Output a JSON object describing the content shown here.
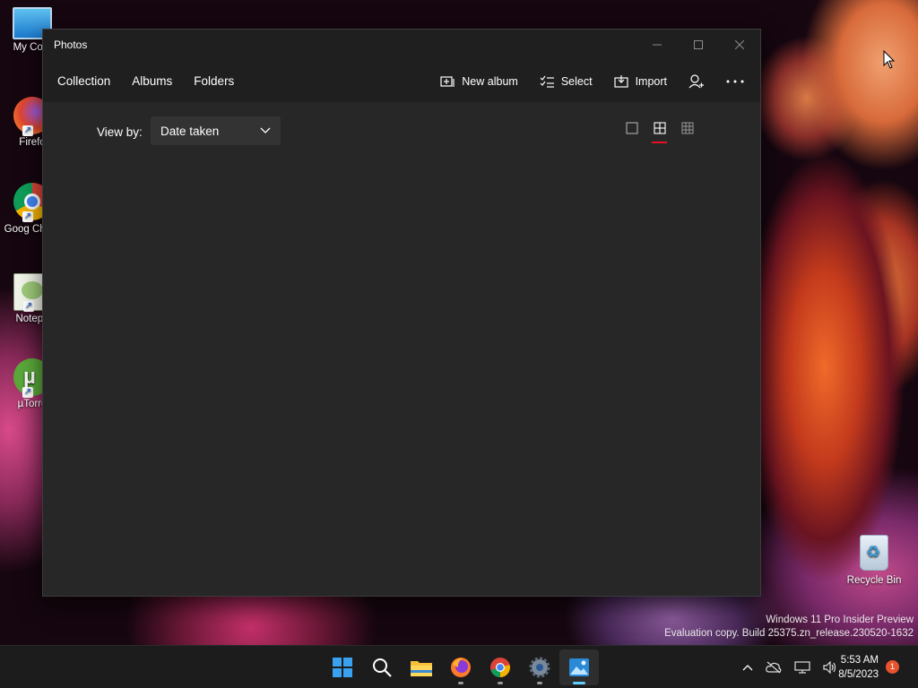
{
  "desktop": {
    "icons": [
      {
        "label": "My Com",
        "icon": "computer-icon"
      },
      {
        "label": "Firefo",
        "icon": "firefox-icon"
      },
      {
        "label": "Goog Chron",
        "icon": "chrome-icon"
      },
      {
        "label": "Notepa",
        "icon": "notepad-icon"
      },
      {
        "label": "µTorre",
        "icon": "utorrent-icon"
      }
    ],
    "recycle_bin": "Recycle Bin",
    "watermark": {
      "line1": "Windows 11 Pro Insider Preview",
      "line2": "Evaluation copy. Build 25375.zn_release.230520-1632"
    }
  },
  "window": {
    "title": "Photos",
    "nav": {
      "collection": "Collection",
      "albums": "Albums",
      "folders": "Folders"
    },
    "actions": {
      "new_album": "New album",
      "select": "Select",
      "import": "Import"
    },
    "view_by": {
      "label": "View by:",
      "value": "Date taken"
    }
  },
  "taskbar": {
    "apps": [
      "start-icon",
      "search-icon",
      "file-explorer-icon",
      "firefox-icon",
      "chrome-icon",
      "settings-icon",
      "photos-icon"
    ],
    "clock": {
      "time": "5:53 AM",
      "date": "8/5/2023"
    },
    "notification_count": "1"
  },
  "colors": {
    "accent_red": "#e81123",
    "taskbar_active": "#60cdff"
  }
}
